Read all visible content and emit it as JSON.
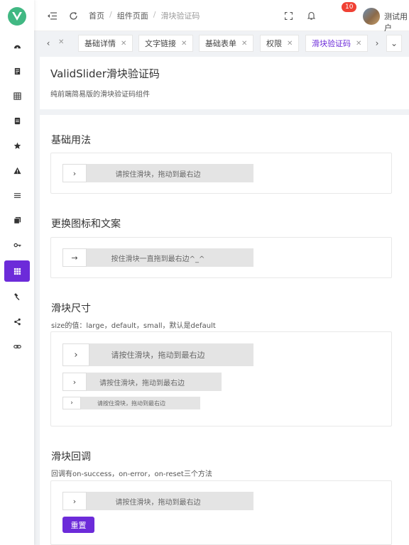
{
  "colors": {
    "accent": "#6c2bd9",
    "logo": "#41b883",
    "badge": "#f04134"
  },
  "sidebar": {
    "logo_letter": "V",
    "items": [
      {
        "icon": "dashboard-icon"
      },
      {
        "icon": "document-icon"
      },
      {
        "icon": "table-grid-icon"
      },
      {
        "icon": "form-icon"
      },
      {
        "icon": "star-icon"
      },
      {
        "icon": "warning-icon"
      },
      {
        "icon": "list-icon"
      },
      {
        "icon": "copy-icon"
      },
      {
        "icon": "key-icon"
      },
      {
        "icon": "component-grid-icon",
        "active": true
      },
      {
        "icon": "hammer-icon"
      },
      {
        "icon": "share-icon"
      },
      {
        "icon": "link-icon"
      }
    ]
  },
  "header": {
    "breadcrumb": [
      "首页",
      "组件页面",
      "滑块验证码"
    ],
    "notification_count": "10",
    "username": "测试用户"
  },
  "tabs": {
    "items": [
      {
        "label": "基础详情"
      },
      {
        "label": "文字链接"
      },
      {
        "label": "基础表单"
      },
      {
        "label": "权限"
      },
      {
        "label": "滑块验证码",
        "active": true
      }
    ],
    "close_glyph": "✕"
  },
  "page": {
    "title": "ValidSlider滑块验证码",
    "description": "纯前端简易版的滑块验证码组件"
  },
  "sections": {
    "basic": {
      "title": "基础用法",
      "slider_text": "请按住滑块，拖动到最右边"
    },
    "custom": {
      "title": "更换图标和文案",
      "slider_text": "按住滑块一直拖到最右边^_^"
    },
    "size": {
      "title": "滑块尺寸",
      "description": "size的值：large，default，small，默认是default",
      "slider_text": "请按住滑块，拖动到最右边"
    },
    "callback": {
      "title": "滑块回调",
      "description": "回调有on-success，on-error，on-reset三个方法",
      "slider_text": "请按住滑块，拖动到最右边",
      "reset_label": "重置"
    }
  }
}
